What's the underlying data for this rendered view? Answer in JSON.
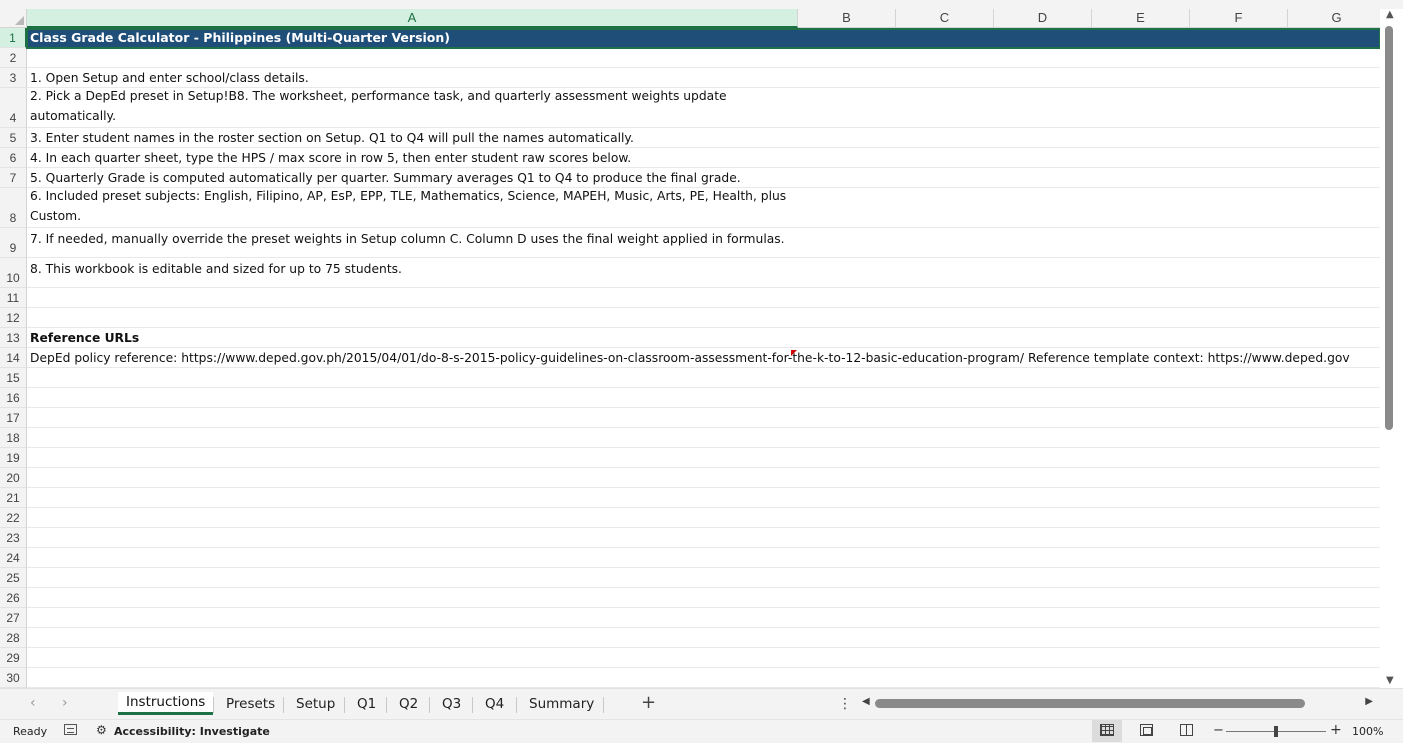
{
  "columns": [
    "A",
    "B",
    "C",
    "D",
    "E",
    "F",
    "G"
  ],
  "rows": [
    {
      "num": "1",
      "text": "Class Grade Calculator - Philippines (Multi-Quarter Version)"
    },
    {
      "num": "2",
      "text": ""
    },
    {
      "num": "3",
      "text": "1. Open Setup and enter school/class details."
    },
    {
      "num": "4",
      "text": "2. Pick a DepEd preset in Setup!B8. The worksheet, performance task, and quarterly assessment weights update automatically."
    },
    {
      "num": "5",
      "text": "3. Enter student names in the roster section on Setup. Q1 to Q4 will pull the names automatically."
    },
    {
      "num": "6",
      "text": "4. In each quarter sheet, type the HPS / max score in row 5, then enter student raw scores below."
    },
    {
      "num": "7",
      "text": "5. Quarterly Grade is computed automatically per quarter. Summary averages Q1 to Q4 to produce the final grade."
    },
    {
      "num": "8",
      "text": "6. Included preset subjects: English, Filipino, AP, EsP, EPP, TLE, Mathematics, Science, MAPEH, Music, Arts, PE, Health, plus Custom."
    },
    {
      "num": "9",
      "text": "7. If needed, manually override the preset weights in Setup column C. Column D uses the final weight applied in formulas."
    },
    {
      "num": "10",
      "text": "8. This workbook is editable and sized for up to 75 students."
    },
    {
      "num": "11",
      "text": ""
    },
    {
      "num": "12",
      "text": ""
    },
    {
      "num": "13",
      "text": "Reference URLs"
    },
    {
      "num": "14",
      "text": "DepEd policy reference: https://www.deped.gov.ph/2015/04/01/do-8-s-2015-policy-guidelines-on-classroom-assessment-for-the-k-to-12-basic-education-program/ Reference template context: https://www.deped.gov"
    },
    {
      "num": "15",
      "text": ""
    },
    {
      "num": "16",
      "text": ""
    },
    {
      "num": "17",
      "text": ""
    },
    {
      "num": "18",
      "text": ""
    },
    {
      "num": "19",
      "text": ""
    },
    {
      "num": "20",
      "text": ""
    },
    {
      "num": "21",
      "text": ""
    },
    {
      "num": "22",
      "text": ""
    },
    {
      "num": "23",
      "text": ""
    },
    {
      "num": "24",
      "text": ""
    },
    {
      "num": "25",
      "text": ""
    },
    {
      "num": "26",
      "text": ""
    },
    {
      "num": "27",
      "text": ""
    },
    {
      "num": "28",
      "text": ""
    },
    {
      "num": "29",
      "text": ""
    },
    {
      "num": "30",
      "text": ""
    }
  ],
  "sheet_tabs": [
    "Instructions",
    "Presets",
    "Setup",
    "Q1",
    "Q2",
    "Q3",
    "Q4",
    "Summary"
  ],
  "active_tab": "Instructions",
  "status": {
    "ready": "Ready",
    "accessibility": "Accessibility: Investigate",
    "zoom": "100%"
  },
  "icons": {
    "add_sheet": "plus-icon",
    "more": "vertical-ellipsis-icon",
    "scroll_up": "triangle-up-icon",
    "scroll_down": "triangle-down-icon",
    "scroll_left": "triangle-left-icon",
    "scroll_right": "triangle-right-icon"
  },
  "colors": {
    "title_fill": "#1f4e79",
    "selection": "#1e7145",
    "comment_marker": "#d00000"
  }
}
